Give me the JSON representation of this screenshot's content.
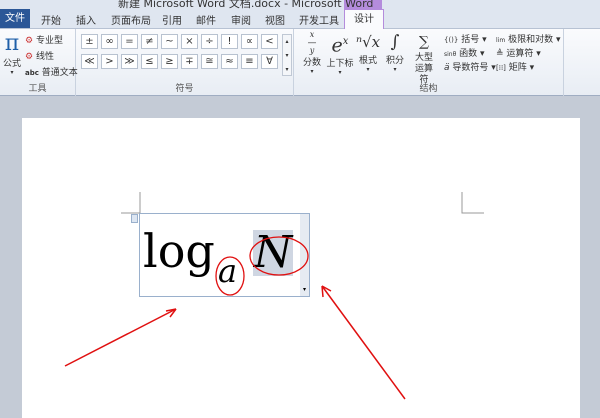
{
  "window": {
    "title": "新建 Microsoft Word 文档.docx - Microsoft Word"
  },
  "tabs": [
    "文件",
    "开始",
    "插入",
    "页面布局",
    "引用",
    "邮件",
    "审阅",
    "视图",
    "开发工具",
    "设计"
  ],
  "active_tab": "设计",
  "tools_group": {
    "label": "工具",
    "equation": "公式",
    "professional": "专业型",
    "linear": "线性",
    "normal_text": "普通文本",
    "abc": "abc"
  },
  "symbols_group": {
    "label": "符号",
    "row1": [
      "±",
      "∞",
      "=",
      "≠",
      "~",
      "×",
      "÷",
      "!",
      "∝",
      "<"
    ],
    "row2": [
      "≪",
      ">",
      "≫",
      "≤",
      "≥",
      "∓",
      "≅",
      "≈",
      "≡",
      "∀"
    ]
  },
  "structures_group": {
    "label": "结构",
    "fraction": "分数",
    "script": "上下标",
    "radical": "根式",
    "integral": "积分",
    "large_operator": "大型运算符",
    "bracket": "括号",
    "function": "函数",
    "accent": "导数符号",
    "limit_log": "极限和对数",
    "operator": "运算符",
    "matrix": "矩阵"
  },
  "equation": {
    "base": "log",
    "subscript": "a",
    "argument": "N"
  },
  "colors": {
    "file_tab": "#2b5797",
    "annotation": "#e01010",
    "context_tab": "#b48cdc"
  }
}
